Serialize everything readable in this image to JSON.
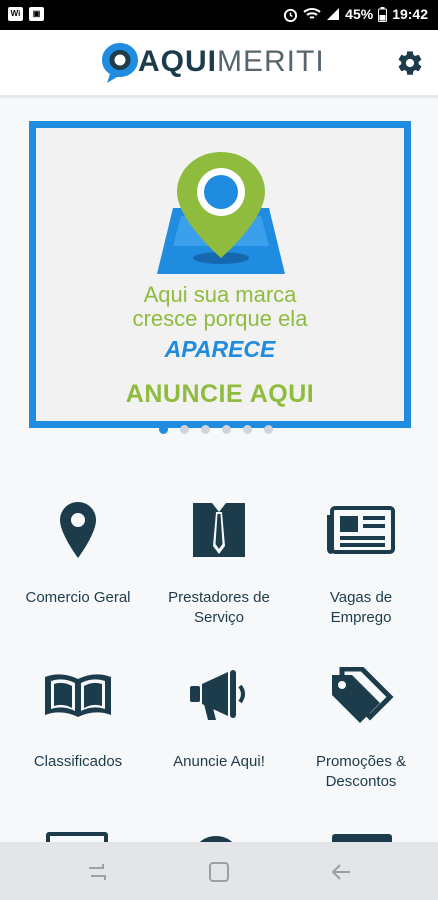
{
  "status_bar": {
    "left_icons": [
      "wifi-calling-icon",
      "gallery-icon"
    ],
    "battery": "45%",
    "time": "19:42"
  },
  "header": {
    "logo_bold": "AQUI",
    "logo_light": "MERITI",
    "settings_icon": "gear-icon"
  },
  "banner": {
    "line1": "Aqui sua marca",
    "line2": "cresce porque ela",
    "brand": "APARECE",
    "cta": "ANUNCIE AQUI",
    "slide_count": 6,
    "active_slide": 1
  },
  "categories": [
    {
      "label_1": "Comercio Geral",
      "label_2": "",
      "icon": "map-pin-icon"
    },
    {
      "label_1": "Prestadores de",
      "label_2": "Serviço",
      "icon": "suit-tie-icon"
    },
    {
      "label_1": "Vagas de",
      "label_2": "Emprego",
      "icon": "newspaper-icon"
    },
    {
      "label_1": "Classificados",
      "label_2": "",
      "icon": "open-book-icon"
    },
    {
      "label_1": "Anuncie Aqui!",
      "label_2": "",
      "icon": "megaphone-icon"
    },
    {
      "label_1": "Promoções &",
      "label_2": "Descontos",
      "icon": "price-tags-icon"
    }
  ],
  "colors": {
    "primary_dark": "#1c3c4c",
    "accent_blue": "#1f8ce0",
    "accent_green": "#8fbc3f"
  }
}
